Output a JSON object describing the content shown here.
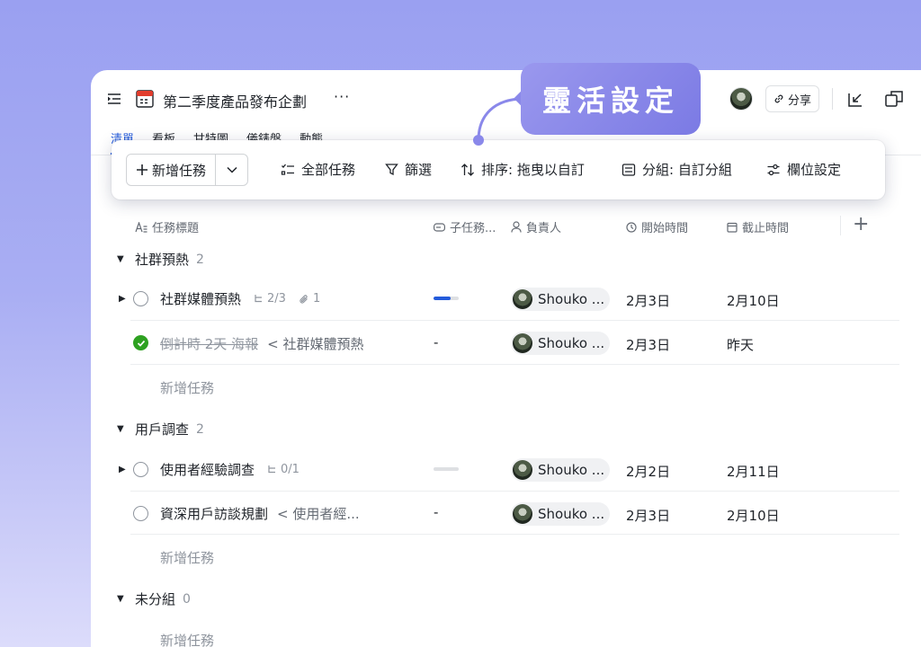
{
  "callout": {
    "text": "靈活設定"
  },
  "header": {
    "title": "第二季度產品發布企劃",
    "more": "···",
    "share_label": "分享"
  },
  "tabs": [
    {
      "label": "清單",
      "active": true
    },
    {
      "label": "看板"
    },
    {
      "label": "甘特圖"
    },
    {
      "label": "儀錶盤"
    },
    {
      "label": "動態"
    }
  ],
  "toolbar": {
    "new_task": "新增任務",
    "all_tasks": "全部任務",
    "filter": "篩選",
    "sort": "排序:  拖曳以自訂",
    "group": "分組:  自訂分組",
    "fields": "欄位設定"
  },
  "columns": {
    "title": "任務標題",
    "subtasks": "子任務...",
    "assignee": "負責人",
    "start": "開始時間",
    "due": "截止時間"
  },
  "groups": [
    {
      "name": "社群預熱",
      "count": "2",
      "tasks": [
        {
          "title": "社群媒體預熱",
          "subtasks": "2/3",
          "attachments": "1",
          "progress": 0.67,
          "assignee": "Shouko ...",
          "start": "2月3日",
          "due": "2月10日"
        },
        {
          "title": "倒計時 2天 海報",
          "done": true,
          "parent": "社群媒體預熱",
          "subtask_value": "-",
          "assignee": "Shouko ...",
          "start": "2月3日",
          "due": "昨天"
        }
      ],
      "add_label": "新增任務"
    },
    {
      "name": "用戶調查",
      "count": "2",
      "tasks": [
        {
          "title": "使用者經驗調查",
          "subtasks": "0/1",
          "progress": 0,
          "assignee": "Shouko ...",
          "start": "2月2日",
          "due": "2月11日"
        },
        {
          "title": "資深用戶訪談規劃",
          "parent": "使用者經...",
          "subtask_value": "-",
          "assignee": "Shouko ...",
          "start": "2月3日",
          "due": "2月10日"
        }
      ],
      "add_label": "新增任務"
    },
    {
      "name": "未分組",
      "count": "0",
      "add_label": "新增任務"
    }
  ],
  "colors": {
    "accent": "#245bdb",
    "done": "#2ea121",
    "callout": "#8a88ea"
  }
}
